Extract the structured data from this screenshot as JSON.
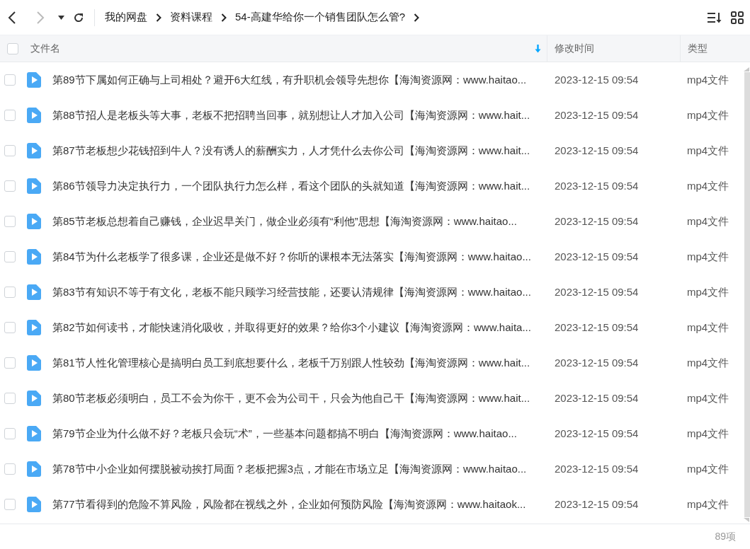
{
  "breadcrumb": [
    "我的网盘",
    "资料课程",
    "54-高建华给你一个销售团队怎么管?"
  ],
  "table": {
    "select_all": {
      "checked": false
    },
    "columns": [
      {
        "label": "文件名",
        "sorted": true
      },
      {
        "label": "修改时间",
        "sorted": false
      },
      {
        "label": "类型",
        "sorted": false
      }
    ],
    "rows": [
      {
        "checked": false,
        "name": "第89节下属如何正确与上司相处？避开6大红线，有升职机会领导先想你【海淘资源网：www.haitao...",
        "modified": "2023-12-15 09:54",
        "type": "mp4文件"
      },
      {
        "checked": false,
        "name": "第88节招人是老板头等大事，老板不把招聘当回事，就别想让人才加入公司【海淘资源网：www.hait...",
        "modified": "2023-12-15 09:54",
        "type": "mp4文件"
      },
      {
        "checked": false,
        "name": "第87节老板想少花钱招到牛人？没有诱人的薪酬实力，人才凭什么去你公司【海淘资源网：www.hait...",
        "modified": "2023-12-15 09:54",
        "type": "mp4文件"
      },
      {
        "checked": false,
        "name": "第86节领导力决定执行力，一个团队执行力怎么样，看这个团队的头就知道【海淘资源网：www.hait...",
        "modified": "2023-12-15 09:54",
        "type": "mp4文件"
      },
      {
        "checked": false,
        "name": "第85节老板总想着自己赚钱，企业迟早关门，做企业必须有“利他”思想【海淘资源网：www.haitao...",
        "modified": "2023-12-15 09:54",
        "type": "mp4文件"
      },
      {
        "checked": false,
        "name": "第84节为什么老板学了很多课，企业还是做不好？你听的课根本无法落实【海淘资源网：www.haitao...",
        "modified": "2023-12-15 09:54",
        "type": "mp4文件"
      },
      {
        "checked": false,
        "name": "第83节有知识不等于有文化，老板不能只顾学习经营技能，还要认清规律【海淘资源网：www.haitao...",
        "modified": "2023-12-15 09:54",
        "type": "mp4文件"
      },
      {
        "checked": false,
        "name": "第82节如何读书，才能快速消化吸收，并取得更好的效果？给你3个小建议【海淘资源网：www.haita...",
        "modified": "2023-12-15 09:54",
        "type": "mp4文件"
      },
      {
        "checked": false,
        "name": "第81节人性化管理核心是搞明白员工到底想要什么，老板千万别跟人性较劲【海淘资源网：www.hait...",
        "modified": "2023-12-15 09:54",
        "type": "mp4文件"
      },
      {
        "checked": false,
        "name": "第80节老板必须明白，员工不会为你干，更不会为公司干，只会为他自己干【海淘资源网：www.hait...",
        "modified": "2023-12-15 09:54",
        "type": "mp4文件"
      },
      {
        "checked": false,
        "name": "第79节企业为什么做不好？老板只会玩“术”，一些基本问题都搞不明白【海淘资源网：www.haitao...",
        "modified": "2023-12-15 09:54",
        "type": "mp4文件"
      },
      {
        "checked": false,
        "name": "第78节中小企业如何摆脱被动挨打局面？老板把握3点，才能在市场立足【海淘资源网：www.haitao...",
        "modified": "2023-12-15 09:54",
        "type": "mp4文件"
      },
      {
        "checked": false,
        "name": "第77节看得到的危险不算风险，风险都在视线之外，企业如何预防风险【海淘资源网：www.haitaok...",
        "modified": "2023-12-15 09:54",
        "type": "mp4文件"
      }
    ]
  },
  "status_bar": {
    "count": "89项"
  }
}
